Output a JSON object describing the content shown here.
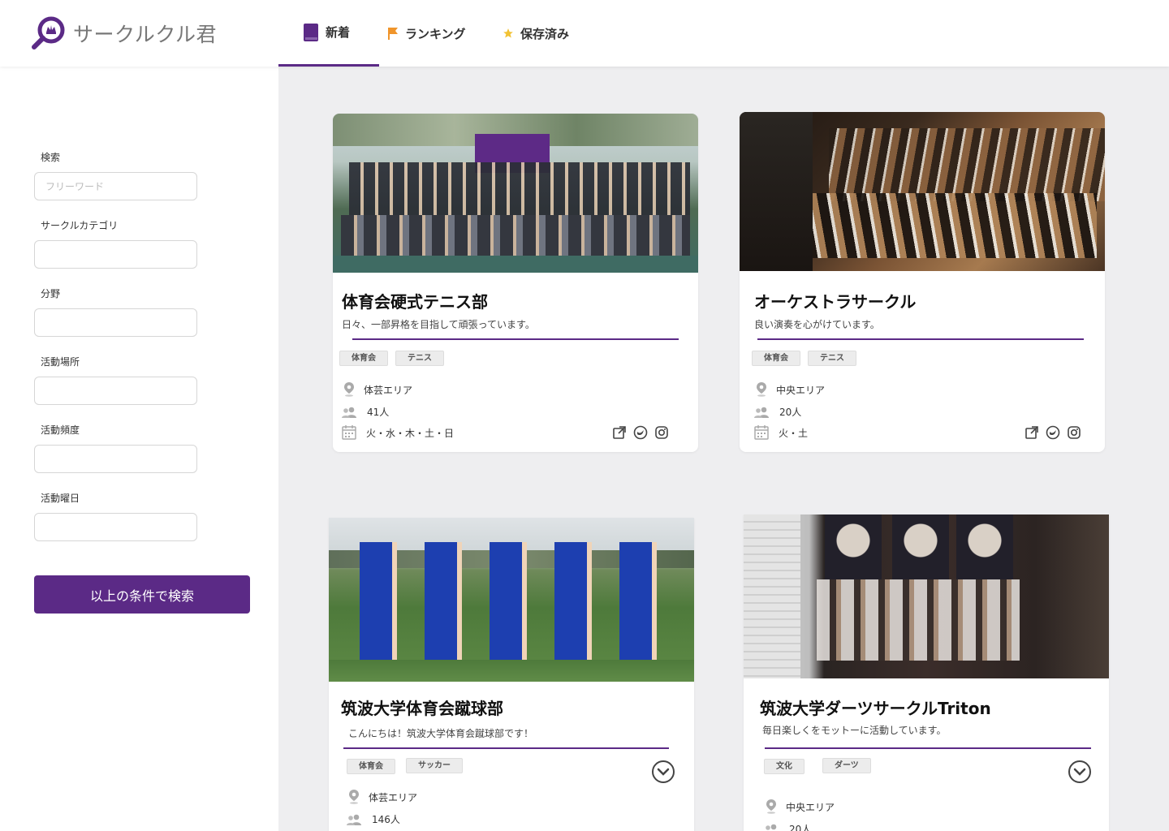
{
  "app": {
    "title": "サークルクル君"
  },
  "nav": [
    {
      "label": "新着",
      "icon": "book-icon",
      "color": "#5b2a86"
    },
    {
      "label": "ランキング",
      "icon": "flag-icon",
      "color": "#f0952b"
    },
    {
      "label": "保存済み",
      "icon": "star-icon",
      "color": "#f2c233"
    }
  ],
  "sidebar": {
    "search_label": "検索",
    "search_placeholder": "フリーワード",
    "category_label": "サークルカテゴリ",
    "field_label": "分野",
    "place_label": "活動場所",
    "frequency_label": "活動頻度",
    "weekday_label": "活動曜日",
    "submit_label": "以上の条件で検索"
  },
  "cards": [
    {
      "title": "体育会硬式テニス部",
      "description": "日々、一部昇格を目指して頑張っています。",
      "tags": [
        "体育会",
        "テニス"
      ],
      "area": "体芸エリア",
      "members": "41人",
      "days": "火・水・木・土・日"
    },
    {
      "title": "オーケストラサークル",
      "description": "良い演奏を心がけています。",
      "tags": [
        "体育会",
        "テニス"
      ],
      "area": "中央エリア",
      "members": "20人",
      "days": "火・土"
    },
    {
      "title": "筑波大学体育会蹴球部",
      "description": "こんにちは！筑波大学体育会蹴球部です！",
      "tags": [
        "体育会",
        "サッカー"
      ],
      "area": "体芸エリア",
      "members": "146人"
    },
    {
      "title": "筑波大学ダーツサークルTriton",
      "description": "毎日楽しくをモットーに活動しています。",
      "tags": [
        "文化",
        "ダーツ"
      ],
      "area": "中央エリア",
      "members": "20人"
    }
  ],
  "colors": {
    "accent": "#5b2a86",
    "background": "#eeeef0"
  }
}
